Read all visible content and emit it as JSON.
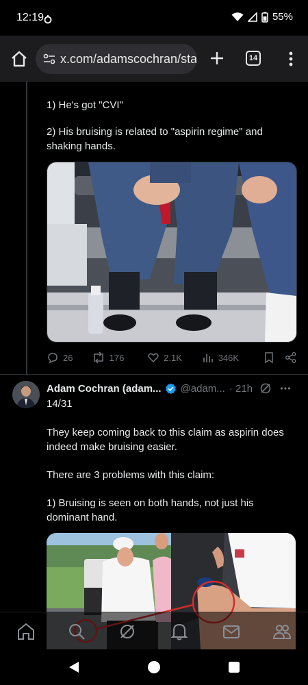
{
  "status_bar": {
    "time": "12:19",
    "battery": "55%"
  },
  "browser": {
    "url": "x.com/adamscochran/sta",
    "tab_count": "14"
  },
  "tweet1": {
    "text_line1": "1) He's got \"CVI\"",
    "text_line2": "2) His bruising is related to \"aspirin regime\" and",
    "text_line3": "shaking hands.",
    "replies": "26",
    "reposts": "176",
    "likes": "2.1K",
    "views": "346K"
  },
  "tweet2": {
    "author": "Adam Cochran (adam...",
    "handle": "@adam...",
    "time": "· 21h",
    "counter": "14/31",
    "para1_line1": "They keep coming back to this claim as aspirin does",
    "para1_line2": "indeed make bruising easier.",
    "para2": "There are 3 problems with this claim:",
    "para3_line1": "1) Bruising is seen on both hands, not just his",
    "para3_line2": "dominant hand."
  },
  "colors": {
    "verified_blue": "#1d9bf0",
    "muted": "#71767b",
    "text": "#e7e9ea",
    "red_circle": "#d42b2b"
  },
  "icons": [
    "home-icon",
    "site-info-icon",
    "plus-icon",
    "tabs-icon",
    "more-vert-icon",
    "reply-icon",
    "repost-icon",
    "like-icon",
    "views-icon",
    "bookmark-icon",
    "share-icon",
    "verified-icon",
    "grok-icon",
    "ellipsis-icon",
    "search-icon",
    "notifications-icon",
    "messages-icon",
    "communities-icon",
    "back-icon",
    "android-home-icon",
    "recents-icon"
  ]
}
